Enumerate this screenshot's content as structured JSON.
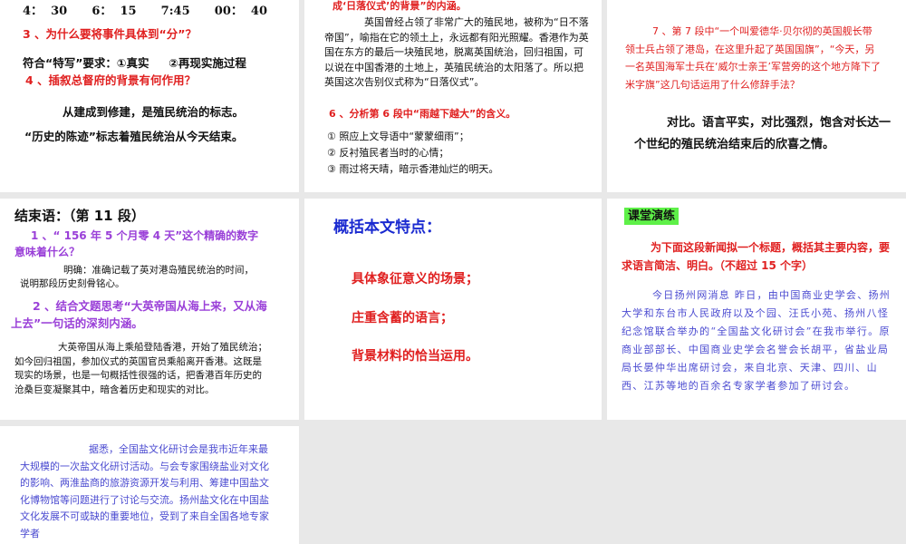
{
  "slides": [
    {
      "times": "4：  30      6：  15      7:45      00：  40",
      "q3": "3 、为什么要将事件具体到“分”？",
      "a3": "符合“特写”要求：①真实     ②再现实施过程",
      "q4": "4 、插叙总督府的背景有何作用？",
      "a4_1": "从建成到修建，是殖民统治的标志。",
      "a4_2": "“历史的陈迹”标志着殖民统治从今天结束。"
    },
    {
      "q_tail": "成‘日落仪式’的背景”的内涵。",
      "answer": "英国曾经占领了非常广大的殖民地，被称为“日不落帝国”，喻指在它的领土上，永远都有阳光照耀。香港作为英国在东方的最后一块殖民地，脱离英国统治，回归祖国，可以说在中国香港的土地上，英殖民统治的太阳落了。所以把英国这次告别仪式称为“日落仪式”。",
      "q6": "6 、分析第 6 段中“雨越下越大”的含义。",
      "a6": [
        "① 照应上文导语中“蒙蒙细雨”；",
        "② 反衬殖民者当时的心情；",
        "③ 雨过将天晴，暗示香港灿烂的明天。"
      ]
    },
    {
      "q7": "7 、第 7 段中“一个叫爱德华·贝尔彻的英国舰长带领士兵占领了港岛，在这里升起了英国国旗”，“今天，另一名英国海军士兵在‘威尔士亲王’军营旁的这个地方降下了米字旗”这几句话运用了什么修辞手法？",
      "a7": "对比。语言平实，对比强烈，饱含对长达一个世纪的殖民统治结束后的欣喜之情。"
    },
    {
      "title": "结束语：（第 11 段）",
      "q1": "1 、“ 156 年 5 个月零 4 天”这个精确的数字意味着什么？",
      "a1": "明确：准确记载了英对港岛殖民统治的时间，说明那段历史刻骨铭心。",
      "q2": "2 、结合文题思考“大英帝国从海上来，又从海上去”一句话的深刻内涵。",
      "a2": "大英帝国从海上乘船登陆香港，开始了殖民统治；如今回归祖国，参加仪式的英国官员乘船离开香港。这既是现实的场景，也是一句概括性很强的话，把香港百年历史的沧桑巨变凝聚其中，暗含着历史和现实的对比。"
    },
    {
      "title": "概括本文特点：",
      "points": [
        "具体象征意义的场景；",
        "庄重含蓄的语言；",
        "背景材料的恰当运用。"
      ]
    },
    {
      "badge": "课堂演练",
      "task": "为下面这段新闻拟一个标题，概括其主要内容，要求语言简洁、明白。（不超过 15 个字）",
      "news": "今日扬州网消息    昨日，由中国商业史学会、扬州大学和东台市人民政府以及个园、汪氏小苑、扬州八怪纪念馆联合举办的“全国盐文化研讨会”在我市举行。原商业部部长、中国商业史学会名誉会长胡平，省盐业局局长晏仲华出席研讨会，来自北京、天津、四川、山西、江苏等地的百余名专家学者参加了研讨会。"
    },
    {
      "text": "据悉，全国盐文化研讨会是我市近年来最大规模的一次盐文化研讨活动。与会专家围绕盐业对文化的影响、两淮盐商的旅游资源开发与利用、筹建中国盐文化博物馆等问题进行了讨论与交流。扬州盐文化在中国盐文化发展不可或缺的重要地位，受到了来自全国各地专家学者"
    }
  ]
}
